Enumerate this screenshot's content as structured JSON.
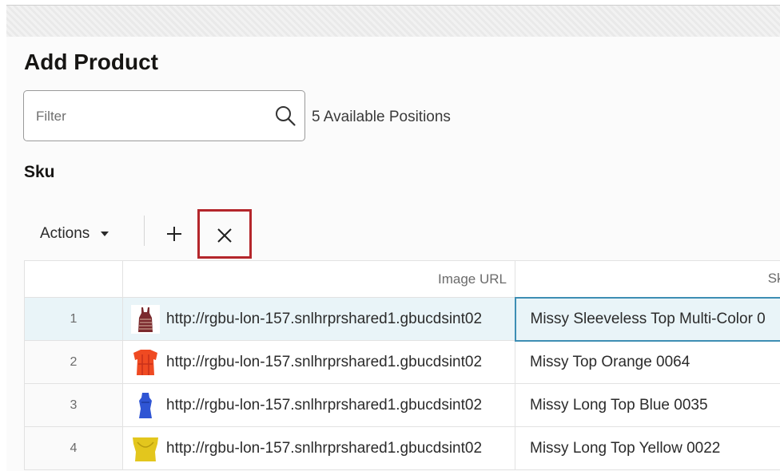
{
  "page": {
    "title": "Add Product"
  },
  "filter": {
    "placeholder": "Filter",
    "value": "",
    "search_icon": "search-icon"
  },
  "available_positions": "5 Available Positions",
  "section": {
    "label": "Sku"
  },
  "toolbar": {
    "actions_label": "Actions",
    "actions_icon": "caret-down-icon",
    "add_icon": "plus-icon",
    "remove_icon": "close-icon",
    "highlight_color": "#b4262b"
  },
  "table": {
    "columns": [
      "",
      "Image URL",
      "Sku"
    ],
    "rows": [
      {
        "num": "1",
        "image_url": "http://rgbu-lon-157.snlhrprshared1.gbucdsint02",
        "sku": "Missy Sleeveless Top Multi-Color 0",
        "thumb": "sleeveless-top-multicolor",
        "selected": true
      },
      {
        "num": "2",
        "image_url": "http://rgbu-lon-157.snlhrprshared1.gbucdsint02",
        "sku": "Missy Top Orange 0064",
        "thumb": "top-orange",
        "selected": false
      },
      {
        "num": "3",
        "image_url": "http://rgbu-lon-157.snlhrprshared1.gbucdsint02",
        "sku": "Missy Long Top Blue 0035",
        "thumb": "long-top-blue",
        "selected": false
      },
      {
        "num": "4",
        "image_url": "http://rgbu-lon-157.snlhrprshared1.gbucdsint02",
        "sku": "Missy Long Top Yellow 0022",
        "thumb": "long-top-yellow",
        "selected": false
      }
    ]
  },
  "colors": {
    "selected_row_bg": "#e9f4f8",
    "selected_cell_border": "#3d8eb4"
  }
}
